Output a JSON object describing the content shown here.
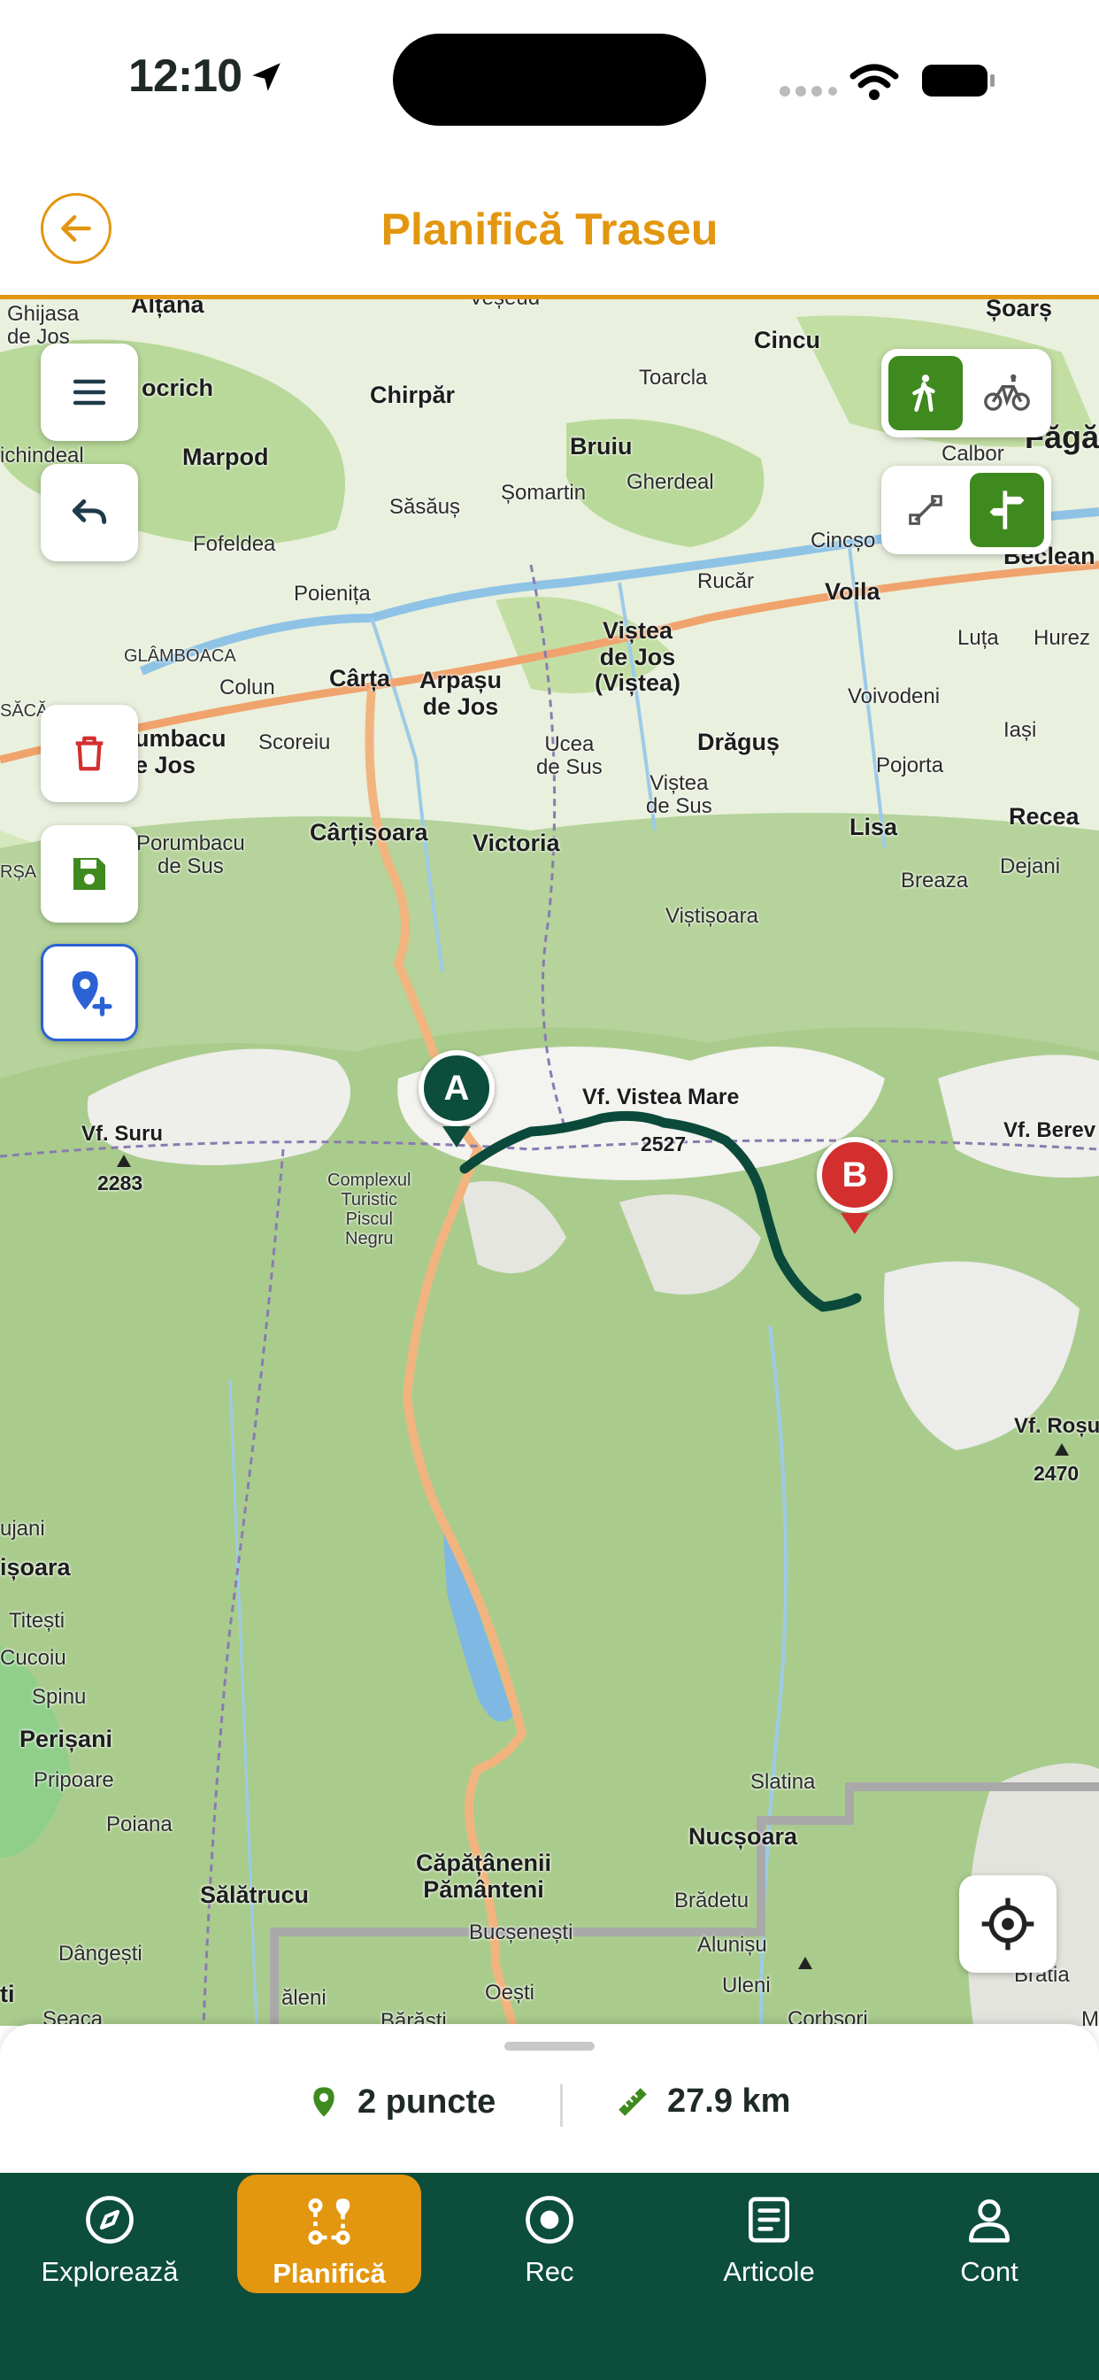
{
  "status_bar": {
    "time": "12:10"
  },
  "header": {
    "title": "Planifică Traseu",
    "back_icon": "arrow-left-icon"
  },
  "map": {
    "labels": {
      "ghijasa": "Ghijasa\nde Jos",
      "altana": "Alțâna",
      "vecsed": "Veșeud",
      "cincu": "Cincu",
      "soars": "Șoarș",
      "bocrich": "ocrich",
      "chirpar": "Chirpăr",
      "toarcla": "Toarcla",
      "fagaras": "Făgă",
      "chindeal": "ichindeal",
      "marpod": "Marpod",
      "bruiu": "Bruiu",
      "calbor": "Calbor",
      "sasaus": "Săsăuș",
      "somartin": "Șomartin",
      "gherdeal": "Gherdeal",
      "fofeldea": "Fofeldea",
      "cincsor": "Cincșo",
      "beclean": "Beclean",
      "poienita": "Poienița",
      "rucar": "Rucăr",
      "voila": "Voila",
      "glamboaca": "GLÂMBOACA",
      "vistea_jos": "Viștea\nde Jos\n(Viștea)",
      "luta": "Luța",
      "hurez": "Hurez",
      "colun": "Colun",
      "carta": "Cârța",
      "arpasu": "Arpașu\nde Jos",
      "voivodeni": "Voivodeni",
      "sacadate": "SĂCĂ",
      "porumbacu_jos": "umbacu\ne Jos",
      "scoreiu": "Scoreiu",
      "ucea": "Ucea\nde Sus",
      "dragus": "Drăguș",
      "iasi": "Iași",
      "vistea_sus": "Viștea\nde Sus",
      "pojorta": "Pojorta",
      "cartisoara": "Cârțișoara",
      "victoria": "Victoria",
      "lisa": "Lisa",
      "recea": "Recea",
      "porumbacu_sus": "Porumbacu\nde Sus",
      "breaza": "Breaza",
      "dejani": "Dejani",
      "rsa": "RȘA",
      "vistisoara": "Viștișoara",
      "vf_vistea": "Vf. Vistea Mare",
      "vistea_alt": "2527",
      "vf_berev": "Vf. Berev",
      "vf_suru": "Vf. Suru",
      "suru_alt": "2283",
      "complexul": "Complexul\nTuristic\nPiscul\nNegru",
      "vf_rosu": "Vf. Roșu",
      "rosu_alt": "2470",
      "ujani": "ujani",
      "isoara": "ișoara",
      "titesti": "Titești",
      "cucoiu": "Cucoiu",
      "spinu": "Spinu",
      "perisani": "Perișani",
      "pripoare": "Pripoare",
      "poiana": "Poiana",
      "slatina": "Slatina",
      "nucsoara": "Nucșoara",
      "capataneni": "Căpățânenii\nPământeni",
      "salatrucu": "Sălătrucu",
      "bradetu": "Brădetu",
      "bucsenesti": "Bucșenești",
      "alunisu": "Alunișu",
      "dangesti": "Dângești",
      "uleni": "Uleni",
      "bratia": "Brătia",
      "aleni": "ăleni",
      "oesti": "Oești",
      "ti": "ti",
      "seaca": "Seaca",
      "barasti": "Bărăști",
      "corbsori": "Corbșori",
      "m": "M"
    },
    "markers": {
      "start": "A",
      "end": "B"
    },
    "controls": {
      "menu_icon": "hamburger-menu-icon",
      "undo_icon": "undo-icon",
      "delete_icon": "trash-icon",
      "save_icon": "floppy-disk-icon",
      "add_point_icon": "map-pin-plus-icon",
      "hike_icon": "hiker-icon",
      "bike_icon": "bicycle-icon",
      "straight_icon": "straight-line-icon",
      "trail_icon": "signpost-icon",
      "locate_icon": "crosshair-icon"
    },
    "colors": {
      "route": "#0b4a3a",
      "road": "#f2b47e",
      "marker_start": "#0c4d3c",
      "marker_end": "#d32f2f"
    }
  },
  "summary": {
    "points": "2 puncte",
    "distance": "27.9 km"
  },
  "tabs": [
    {
      "label": "Explorează",
      "icon": "compass-icon"
    },
    {
      "label": "Planifică",
      "icon": "route-icon"
    },
    {
      "label": "Rec",
      "icon": "record-icon"
    },
    {
      "label": "Articole",
      "icon": "article-icon"
    },
    {
      "label": "Cont",
      "icon": "user-icon"
    }
  ],
  "accent": "#e3960f",
  "tabbar_color": "#0c4d3c"
}
